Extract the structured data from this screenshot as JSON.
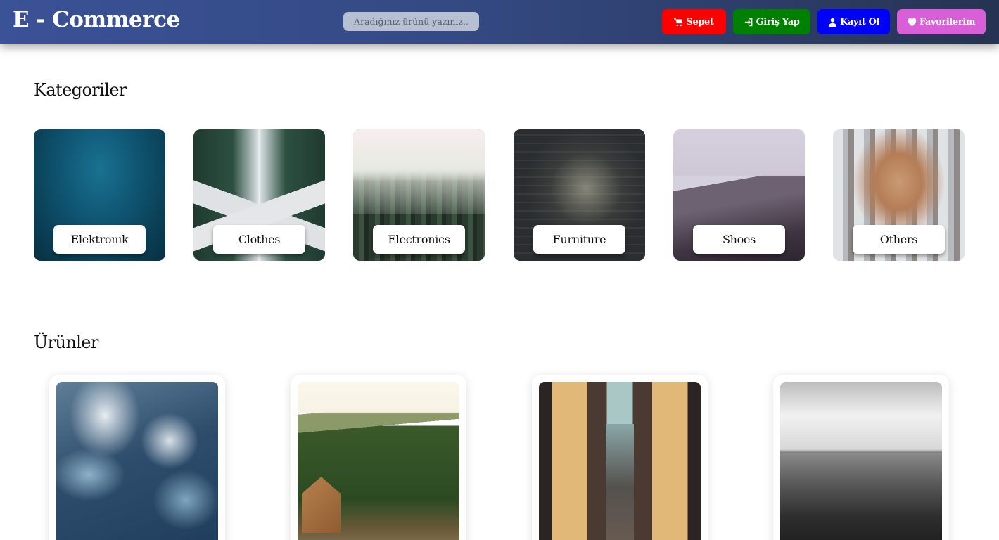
{
  "header": {
    "brand": "E - Commerce",
    "search_placeholder": "Aradığınız ürünü yazınız..",
    "buttons": {
      "cart": "Sepet",
      "login": "Giriş Yap",
      "register": "Kayıt Ol",
      "favorites": "Favorilerim"
    },
    "icons": {
      "cart": "cart-icon",
      "login": "sign-in-icon",
      "register": "user-icon",
      "favorites": "heart-icon"
    },
    "colors": {
      "cart": "#ff0000",
      "login": "#008000",
      "register": "#0000ff",
      "favorites": "#d85fd8"
    }
  },
  "categories": {
    "title": "Kategoriler",
    "items": [
      {
        "label": "Elektronik"
      },
      {
        "label": "Clothes"
      },
      {
        "label": "Electronics"
      },
      {
        "label": "Furniture"
      },
      {
        "label": "Shoes"
      },
      {
        "label": "Others"
      }
    ]
  },
  "products": {
    "title": "Ürünler",
    "count": 4
  }
}
